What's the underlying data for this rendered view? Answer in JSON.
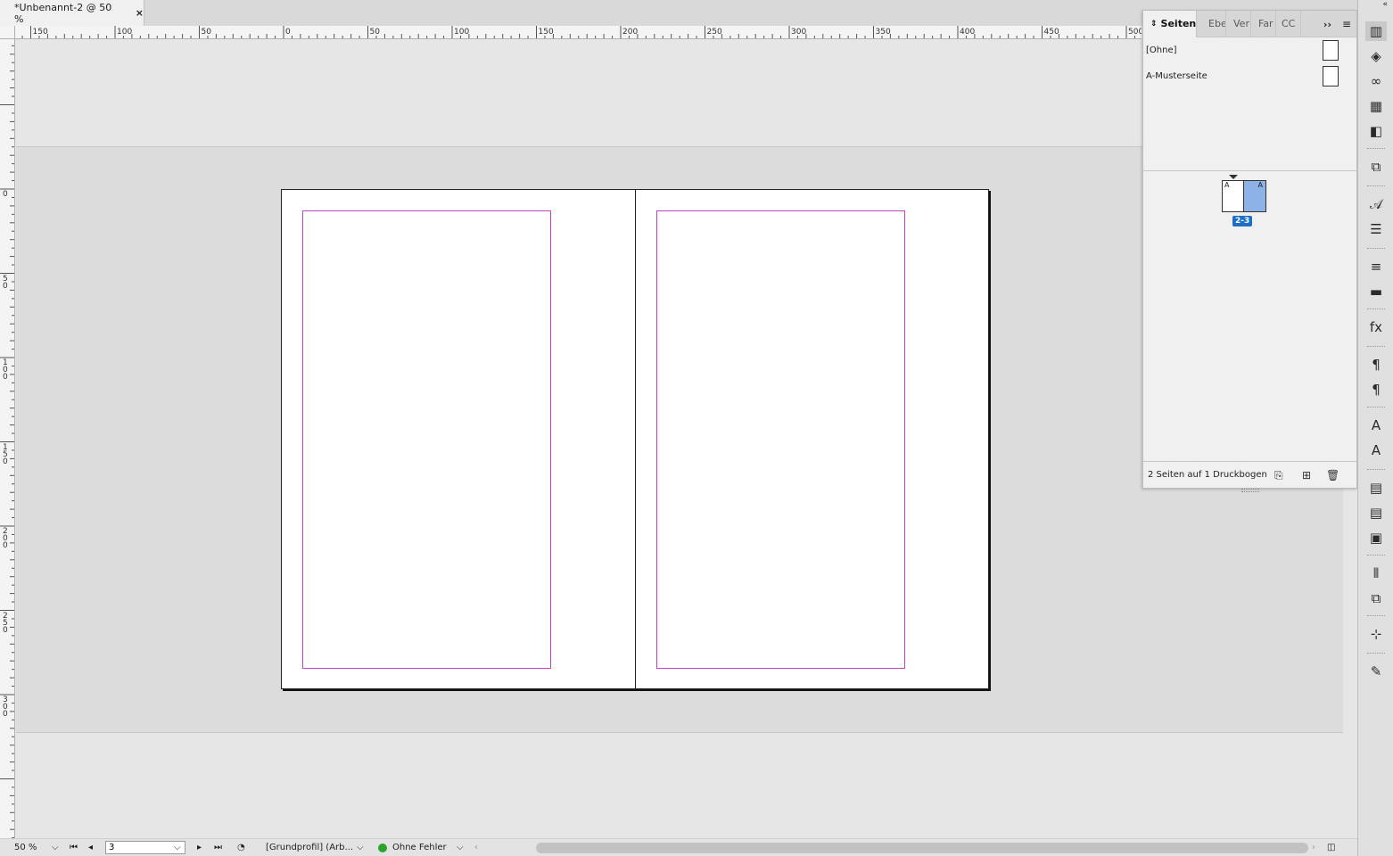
{
  "document": {
    "tab_title": "*Unbenannt-2 @ 50 %",
    "close_symbol": "×"
  },
  "rulers": {
    "horizontal_labels": [
      "150",
      "100",
      "50",
      "0",
      "50",
      "100",
      "150",
      "200",
      "250",
      "300",
      "350",
      "400",
      "450",
      "500"
    ],
    "vertical_labels": [
      "0",
      "50",
      "100",
      "150",
      "200",
      "250",
      "300"
    ]
  },
  "colors": {
    "margin_guide": "#c040c8",
    "selected_page": "#8db2e8",
    "page_label_bg": "#1d6fc4",
    "status_ok": "#2aa52a"
  },
  "pages_panel": {
    "tabs": [
      {
        "label": "Seiten",
        "icon": "chevron-updown-icon"
      },
      {
        "label": "Ebe"
      },
      {
        "label": "Ver"
      },
      {
        "label": "Far"
      },
      {
        "label": "CC"
      }
    ],
    "masters": [
      {
        "label": "[Ohne]"
      },
      {
        "label": "A-Musterseite"
      }
    ],
    "spread": {
      "left_page_master": "A",
      "right_page_master": "A",
      "label": "2-3"
    },
    "footer_text": "2 Seiten auf 1 Druckbogen"
  },
  "dock": {
    "icons": [
      "pages-icon",
      "layers-icon",
      "links-icon",
      "swatches-icon",
      "page-transition-icon",
      "cc-libraries-icon",
      "character-styles-icon",
      "paragraph-align-icon",
      "stroke-icon",
      "gradient-icon",
      "effects-icon",
      "paragraph-icon",
      "paragraph-styles-icon",
      "character-icon",
      "object-styles-icon",
      "table-icon",
      "table-styles-icon",
      "cell-styles-icon",
      "align-icon",
      "pathfinder-icon",
      "transform-icon",
      "scripts-icon"
    ]
  },
  "statusbar": {
    "zoom": "50 %",
    "page_number": "3",
    "profile": "[Grundprofil] (Arb...",
    "preflight": "Ohne Fehler"
  }
}
